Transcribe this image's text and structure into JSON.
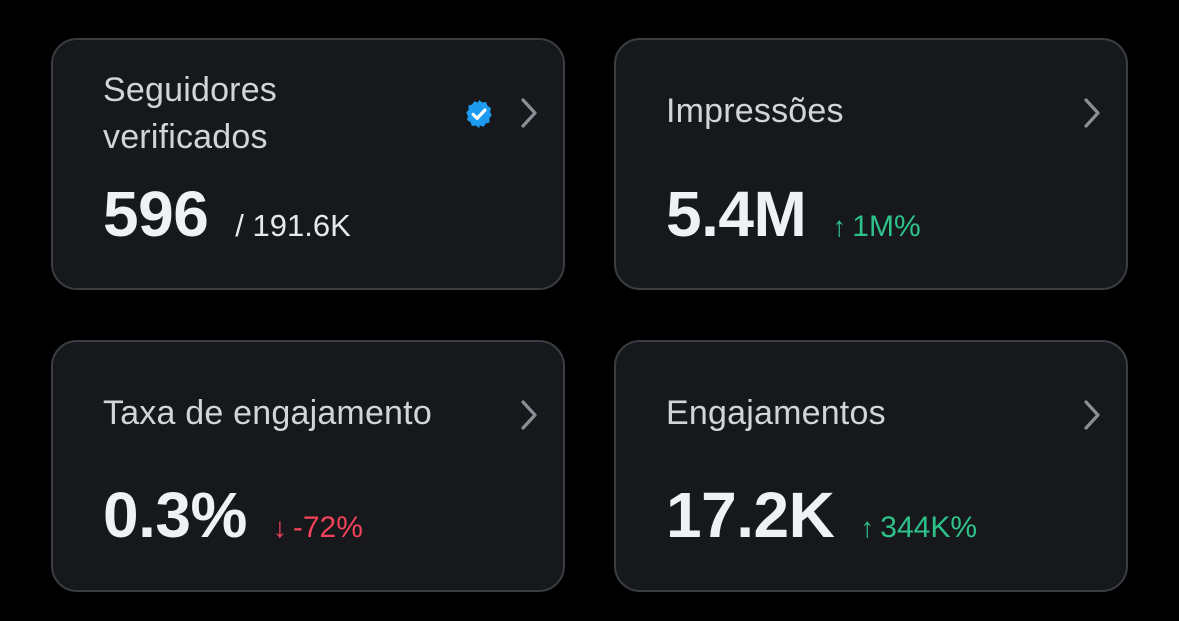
{
  "cards": {
    "verified_followers": {
      "title": "Seguidores verificados",
      "value": "596",
      "total": "/ 191.6K"
    },
    "impressions": {
      "title": "Impressões",
      "value": "5.4M",
      "change_arrow": "↑",
      "change": "1M%"
    },
    "engagement_rate": {
      "title": "Taxa de engajamento",
      "value": "0.3%",
      "change_arrow": "↓",
      "change": "-72%"
    },
    "engagements": {
      "title": "Engajamentos",
      "value": "17.2K",
      "change_arrow": "↑",
      "change": "344K%"
    }
  },
  "icons": {
    "verified": "verified-badge-icon",
    "chevron": "chevron-right-icon"
  },
  "colors": {
    "background": "#000000",
    "card": "#16181c",
    "card_border": "#3a3d42",
    "positive": "#2ec28a",
    "negative": "#f2435a",
    "verified_blue": "#1d9bf0"
  }
}
